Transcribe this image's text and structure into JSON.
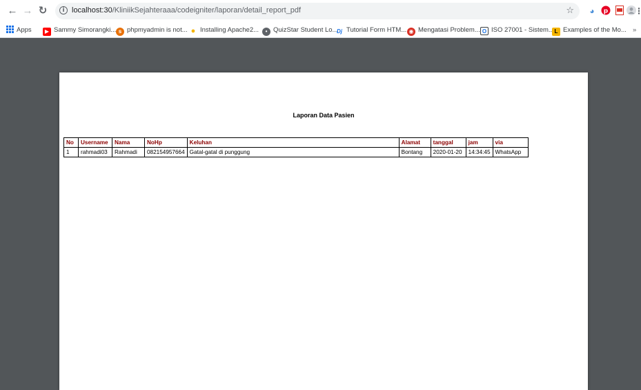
{
  "browser": {
    "url_host": "localhost:30",
    "url_path": "/KliniikSejahteraaa/codeigniter/laporan/detail_report_pdf",
    "bookmarks": [
      {
        "label": "Apps",
        "icon": "apps-grid-icon",
        "color": "#4285f4"
      },
      {
        "label": "Sammy Simorangki...",
        "icon": "youtube-icon",
        "color": "#ff0000"
      },
      {
        "label": "phpmyadmin is not...",
        "icon": "stackoverflow-icon",
        "color": "#e8710a"
      },
      {
        "label": "Installing Apache2...",
        "icon": "lightbulb-icon",
        "color": "#f4b400"
      },
      {
        "label": "QuizStar Student Lo...",
        "icon": "globe-icon",
        "color": "#5f6368"
      },
      {
        "label": "Tutorial Form HTM...",
        "icon": "dj-icon",
        "color": "#1a73e8"
      },
      {
        "label": "Mengatasi Problem...",
        "icon": "blogger-icon",
        "color": "#d93025"
      },
      {
        "label": "ISO 27001 - Sistem...",
        "icon": "bookmark-icon",
        "color": "#3c4043"
      },
      {
        "label": "Examples of the Mo...",
        "icon": "l-icon",
        "color": "#f4b400"
      }
    ],
    "more_bookmarks": "»"
  },
  "report": {
    "title": "Laporan Data Pasien",
    "columns": [
      "No",
      "Username",
      "Nama",
      "NoHp",
      "Keluhan",
      "Alamat",
      "tanggal",
      "jam",
      "via"
    ],
    "rows": [
      [
        "1",
        "rahmadi03",
        "Rahmadi",
        "082154957664",
        "Gatal-gatal di punggung",
        "Bontang",
        "2020-01-20",
        "14:34:45",
        "WhatsApp"
      ]
    ]
  }
}
